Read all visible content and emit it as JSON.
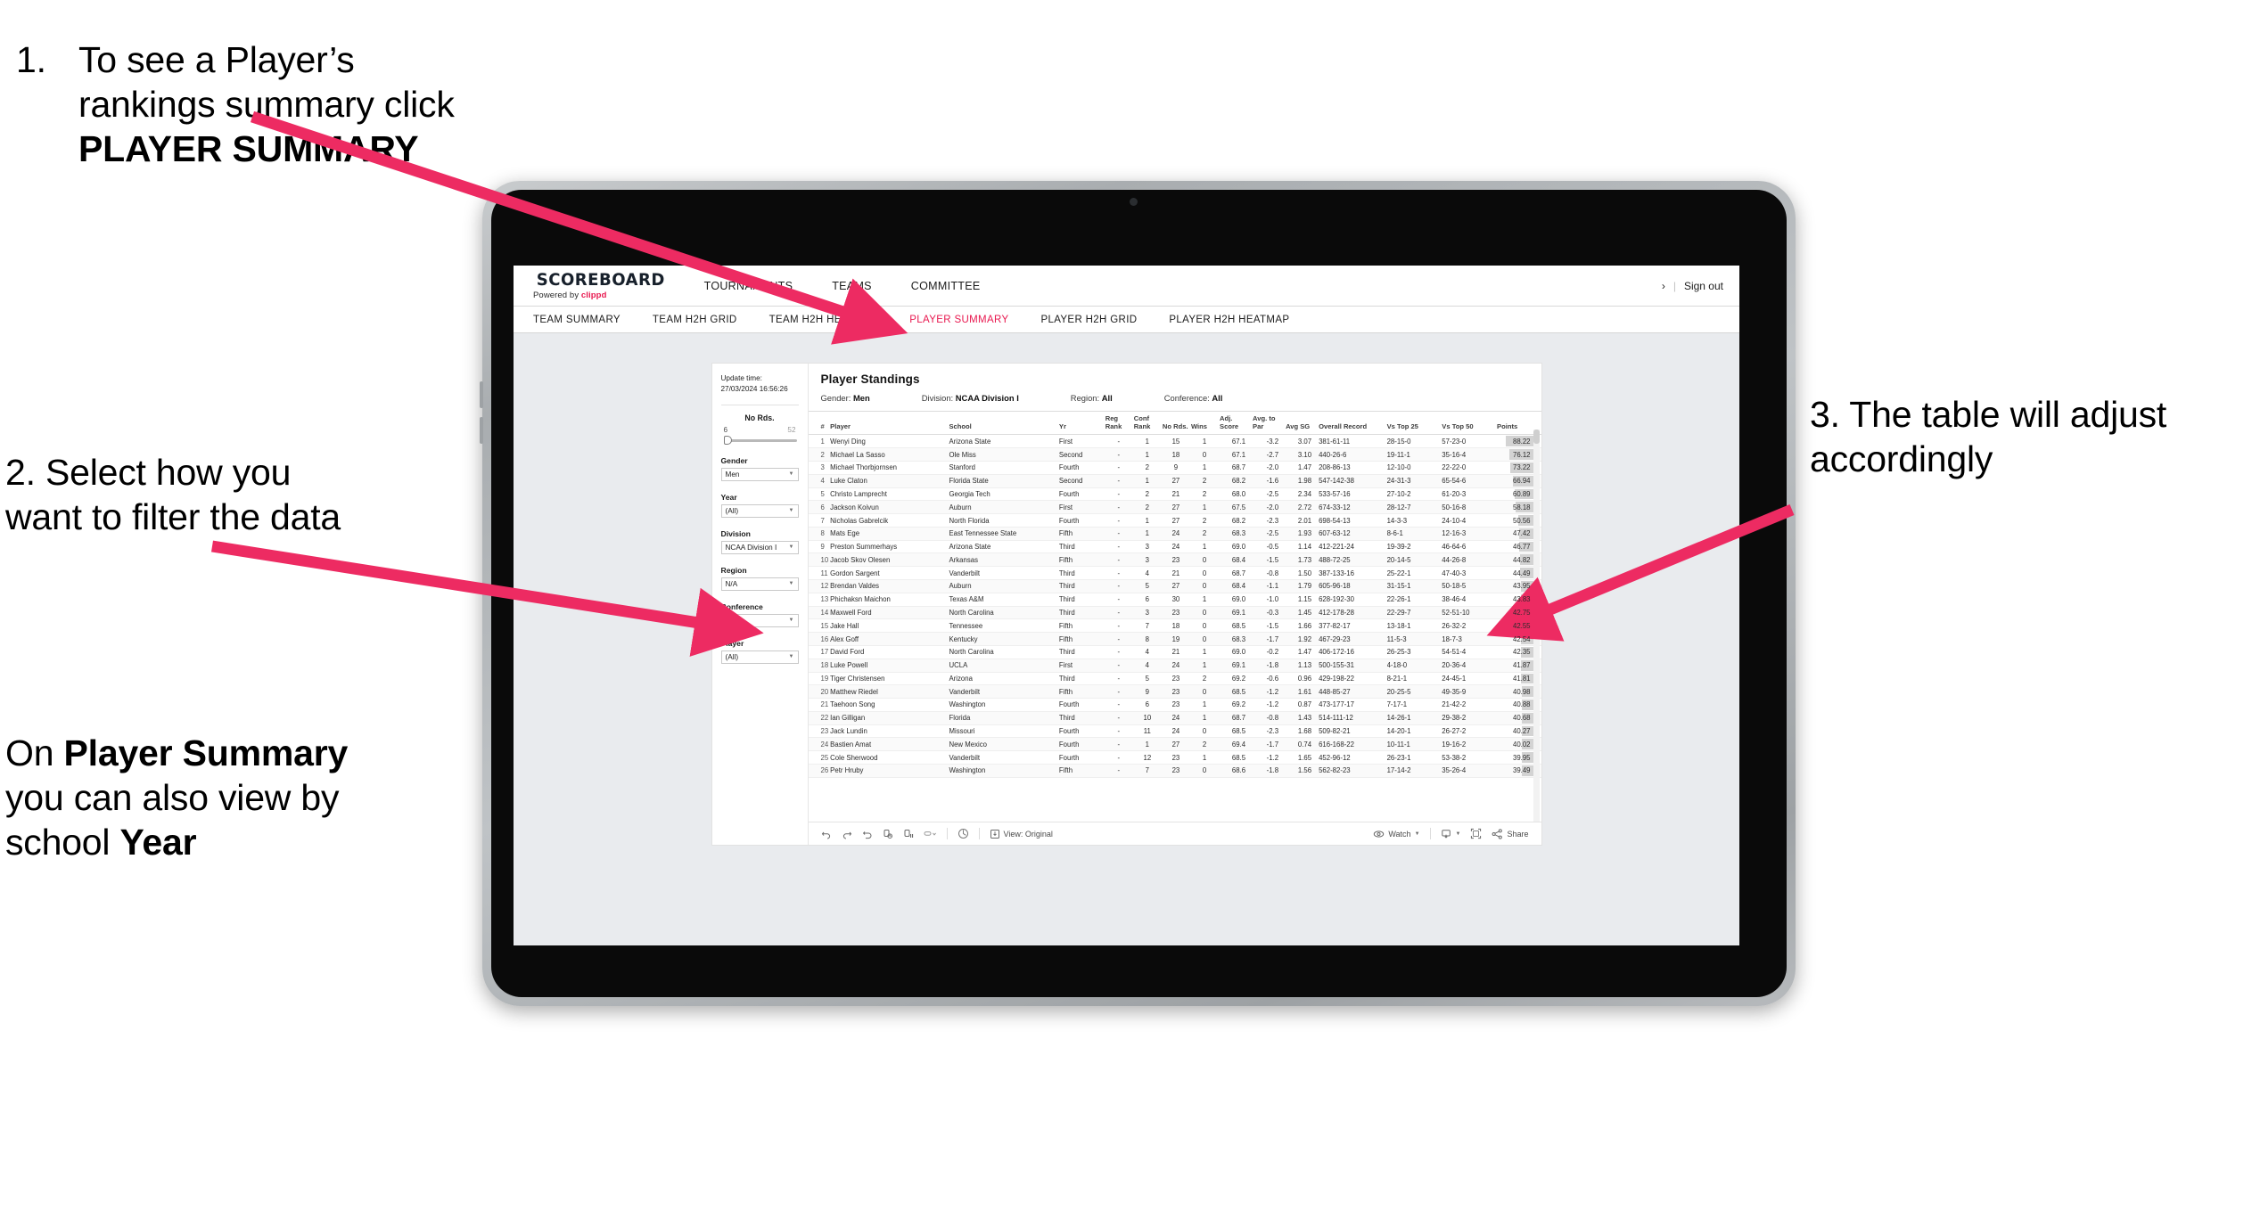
{
  "annotations": {
    "one_num": "1.",
    "one_a": "To see a Player’s rankings summary click ",
    "one_b": "PLAYER SUMMARY",
    "two_a": "2. Select how you want to filter the data",
    "two_b_pre": "On ",
    "two_b_bold": "Player Summary",
    "two_b_mid": " you can also view by school ",
    "two_b_bold2": "Year",
    "three": "3. The table will adjust accordingly",
    "arrow_color": "#ED2B62"
  },
  "app": {
    "brand_title": "SCOREBOARD",
    "brand_powered": "Powered by ",
    "brand_clippd": "clippd",
    "accent": "#E8184F",
    "top_nav": [
      "TOURNAMENTS",
      "TEAMS",
      "COMMITTEE"
    ],
    "sign_out": "Sign out",
    "sub_nav": [
      {
        "label": "TEAM SUMMARY",
        "active": false
      },
      {
        "label": "TEAM H2H GRID",
        "active": false
      },
      {
        "label": "TEAM H2H HEATMAP",
        "active": false
      },
      {
        "label": "PLAYER SUMMARY",
        "active": true
      },
      {
        "label": "PLAYER H2H GRID",
        "active": false
      },
      {
        "label": "PLAYER H2H HEATMAP",
        "active": false
      }
    ]
  },
  "filters": {
    "update_label": "Update time:",
    "update_value": "27/03/2024 16:56:26",
    "rounds_label": "No Rds.",
    "rounds_min": "6",
    "rounds_max": "52",
    "groups": [
      {
        "label": "Gender",
        "value": "Men"
      },
      {
        "label": "Year",
        "value": "(All)"
      },
      {
        "label": "Division",
        "value": "NCAA Division I"
      },
      {
        "label": "Region",
        "value": "N/A"
      },
      {
        "label": "Conference",
        "value": "(All)"
      },
      {
        "label": "Player",
        "value": "(All)"
      }
    ]
  },
  "standings": {
    "title": "Player Standings",
    "meta": [
      {
        "k": "Gender:",
        "v": "Men"
      },
      {
        "k": "Division:",
        "v": "NCAA Division I"
      },
      {
        "k": "Region:",
        "v": "All"
      },
      {
        "k": "Conference:",
        "v": "All"
      }
    ],
    "columns": [
      "#",
      "Player",
      "School",
      "Yr",
      "Reg Rank",
      "Conf Rank",
      "No Rds.",
      "Wins",
      "Adj. Score",
      "Avg. to Par",
      "Avg SG",
      "Overall Record",
      "Vs Top 25",
      "Vs Top 50",
      "Points"
    ],
    "rows": [
      [
        "1",
        "Wenyi Ding",
        "Arizona State",
        "First",
        "-",
        "1",
        "15",
        "1",
        "67.1",
        "-3.2",
        "3.07",
        "381-61-11",
        "28-15-0",
        "57-23-0",
        "88.22"
      ],
      [
        "2",
        "Michael La Sasso",
        "Ole Miss",
        "Second",
        "-",
        "1",
        "18",
        "0",
        "67.1",
        "-2.7",
        "3.10",
        "440-26-6",
        "19-11-1",
        "35-16-4",
        "76.12"
      ],
      [
        "3",
        "Michael Thorbjornsen",
        "Stanford",
        "Fourth",
        "-",
        "2",
        "9",
        "1",
        "68.7",
        "-2.0",
        "1.47",
        "208-86-13",
        "12-10-0",
        "22-22-0",
        "73.22"
      ],
      [
        "4",
        "Luke Claton",
        "Florida State",
        "Second",
        "-",
        "1",
        "27",
        "2",
        "68.2",
        "-1.6",
        "1.98",
        "547-142-38",
        "24-31-3",
        "65-54-6",
        "66.94"
      ],
      [
        "5",
        "Christo Lamprecht",
        "Georgia Tech",
        "Fourth",
        "-",
        "2",
        "21",
        "2",
        "68.0",
        "-2.5",
        "2.34",
        "533-57-16",
        "27-10-2",
        "61-20-3",
        "60.89"
      ],
      [
        "6",
        "Jackson Koivun",
        "Auburn",
        "First",
        "-",
        "2",
        "27",
        "1",
        "67.5",
        "-2.0",
        "2.72",
        "674-33-12",
        "28-12-7",
        "50-16-8",
        "58.18"
      ],
      [
        "7",
        "Nicholas Gabrelcik",
        "North Florida",
        "Fourth",
        "-",
        "1",
        "27",
        "2",
        "68.2",
        "-2.3",
        "2.01",
        "698-54-13",
        "14-3-3",
        "24-10-4",
        "50.56"
      ],
      [
        "8",
        "Mats Ege",
        "East Tennessee State",
        "Fifth",
        "-",
        "1",
        "24",
        "2",
        "68.3",
        "-2.5",
        "1.93",
        "607-63-12",
        "8-6-1",
        "12-16-3",
        "47.42"
      ],
      [
        "9",
        "Preston Summerhays",
        "Arizona State",
        "Third",
        "-",
        "3",
        "24",
        "1",
        "69.0",
        "-0.5",
        "1.14",
        "412-221-24",
        "19-39-2",
        "46-64-6",
        "46.77"
      ],
      [
        "10",
        "Jacob Skov Olesen",
        "Arkansas",
        "Fifth",
        "-",
        "3",
        "23",
        "0",
        "68.4",
        "-1.5",
        "1.73",
        "488-72-25",
        "20-14-5",
        "44-26-8",
        "44.82"
      ],
      [
        "11",
        "Gordon Sargent",
        "Vanderbilt",
        "Third",
        "-",
        "4",
        "21",
        "0",
        "68.7",
        "-0.8",
        "1.50",
        "387-133-16",
        "25-22-1",
        "47-40-3",
        "44.49"
      ],
      [
        "12",
        "Brendan Valdes",
        "Auburn",
        "Third",
        "-",
        "5",
        "27",
        "0",
        "68.4",
        "-1.1",
        "1.79",
        "605-96-18",
        "31-15-1",
        "50-18-5",
        "43.95"
      ],
      [
        "13",
        "Phichaksn Maichon",
        "Texas A&M",
        "Third",
        "-",
        "6",
        "30",
        "1",
        "69.0",
        "-1.0",
        "1.15",
        "628-192-30",
        "22-26-1",
        "38-46-4",
        "43.83"
      ],
      [
        "14",
        "Maxwell Ford",
        "North Carolina",
        "Third",
        "-",
        "3",
        "23",
        "0",
        "69.1",
        "-0.3",
        "1.45",
        "412-178-28",
        "22-29-7",
        "52-51-10",
        "42.75"
      ],
      [
        "15",
        "Jake Hall",
        "Tennessee",
        "Fifth",
        "-",
        "7",
        "18",
        "0",
        "68.5",
        "-1.5",
        "1.66",
        "377-82-17",
        "13-18-1",
        "26-32-2",
        "42.55"
      ],
      [
        "16",
        "Alex Goff",
        "Kentucky",
        "Fifth",
        "-",
        "8",
        "19",
        "0",
        "68.3",
        "-1.7",
        "1.92",
        "467-29-23",
        "11-5-3",
        "18-7-3",
        "42.54"
      ],
      [
        "17",
        "David Ford",
        "North Carolina",
        "Third",
        "-",
        "4",
        "21",
        "1",
        "69.0",
        "-0.2",
        "1.47",
        "406-172-16",
        "26-25-3",
        "54-51-4",
        "42.35"
      ],
      [
        "18",
        "Luke Powell",
        "UCLA",
        "First",
        "-",
        "4",
        "24",
        "1",
        "69.1",
        "-1.8",
        "1.13",
        "500-155-31",
        "4-18-0",
        "20-36-4",
        "41.87"
      ],
      [
        "19",
        "Tiger Christensen",
        "Arizona",
        "Third",
        "-",
        "5",
        "23",
        "2",
        "69.2",
        "-0.6",
        "0.96",
        "429-198-22",
        "8-21-1",
        "24-45-1",
        "41.81"
      ],
      [
        "20",
        "Matthew Riedel",
        "Vanderbilt",
        "Fifth",
        "-",
        "9",
        "23",
        "0",
        "68.5",
        "-1.2",
        "1.61",
        "448-85-27",
        "20-25-5",
        "49-35-9",
        "40.98"
      ],
      [
        "21",
        "Taehoon Song",
        "Washington",
        "Fourth",
        "-",
        "6",
        "23",
        "1",
        "69.2",
        "-1.2",
        "0.87",
        "473-177-17",
        "7-17-1",
        "21-42-2",
        "40.88"
      ],
      [
        "22",
        "Ian Gilligan",
        "Florida",
        "Third",
        "-",
        "10",
        "24",
        "1",
        "68.7",
        "-0.8",
        "1.43",
        "514-111-12",
        "14-26-1",
        "29-38-2",
        "40.68"
      ],
      [
        "23",
        "Jack Lundin",
        "Missouri",
        "Fourth",
        "-",
        "11",
        "24",
        "0",
        "68.5",
        "-2.3",
        "1.68",
        "509-82-21",
        "14-20-1",
        "26-27-2",
        "40.27"
      ],
      [
        "24",
        "Bastien Amat",
        "New Mexico",
        "Fourth",
        "-",
        "1",
        "27",
        "2",
        "69.4",
        "-1.7",
        "0.74",
        "616-168-22",
        "10-11-1",
        "19-16-2",
        "40.02"
      ],
      [
        "25",
        "Cole Sherwood",
        "Vanderbilt",
        "Fourth",
        "-",
        "12",
        "23",
        "1",
        "68.5",
        "-1.2",
        "1.65",
        "452-96-12",
        "26-23-1",
        "53-38-2",
        "39.95"
      ],
      [
        "26",
        "Petr Hruby",
        "Washington",
        "Fifth",
        "-",
        "7",
        "23",
        "0",
        "68.6",
        "-1.8",
        "1.56",
        "562-82-23",
        "17-14-2",
        "35-26-4",
        "39.49"
      ]
    ],
    "points_max": 88.22
  },
  "toolbar": {
    "view_label": "View: Original",
    "watch_label": "Watch",
    "share_label": "Share"
  }
}
